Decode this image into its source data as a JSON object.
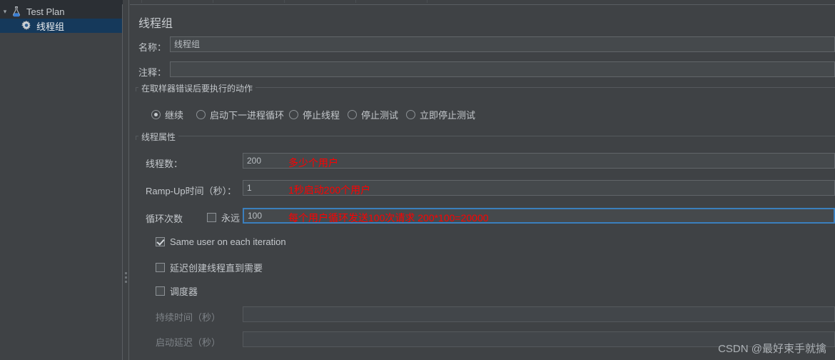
{
  "app": {
    "panel_title": "线程组"
  },
  "tree": {
    "items": [
      {
        "label": "Test Plan",
        "icon": "test-plan-flask-icon",
        "selected": false,
        "expanded": true
      },
      {
        "label": "线程组",
        "icon": "thread-group-gear-icon",
        "selected": true,
        "expanded": false
      }
    ]
  },
  "form": {
    "name_label": "名称：",
    "name_value": "线程组",
    "comment_label": "注释：",
    "comment_value": ""
  },
  "error_action_group": {
    "title": "在取样器错误后要执行的动作",
    "options": [
      {
        "label": "继续",
        "selected": true
      },
      {
        "label": "启动下一进程循环",
        "selected": false
      },
      {
        "label": "停止线程",
        "selected": false
      },
      {
        "label": "停止测试",
        "selected": false
      },
      {
        "label": "立即停止测试",
        "selected": false
      }
    ]
  },
  "thread_properties": {
    "title": "线程属性",
    "threads_label": "线程数：",
    "threads_value": "200",
    "threads_note": "多少个用户",
    "rampup_label": "Ramp-Up时间（秒）：",
    "rampup_value": "1",
    "rampup_note": "1秒启动200个用户",
    "loops_label": "循环次数",
    "forever_label": "永远",
    "forever_checked": false,
    "loops_value": "100",
    "loops_note": "每个用户循环发送100次请求 200*100=20000",
    "same_user_label": "Same user on each iteration",
    "same_user_checked": true,
    "delayed_start_label": "延迟创建线程直到需要",
    "delayed_start_checked": false,
    "scheduler_label": "调度器",
    "scheduler_checked": false,
    "duration_label": "持续时间（秒）",
    "duration_value": "",
    "startup_delay_label": "启动延迟（秒）",
    "startup_delay_value": ""
  },
  "watermark": {
    "text": "CSDN @最好束手就擒"
  },
  "colors": {
    "background": "#3f4245",
    "selection": "#15395b",
    "focus_border": "#3b7fbd",
    "annotation": "#ff0000"
  }
}
